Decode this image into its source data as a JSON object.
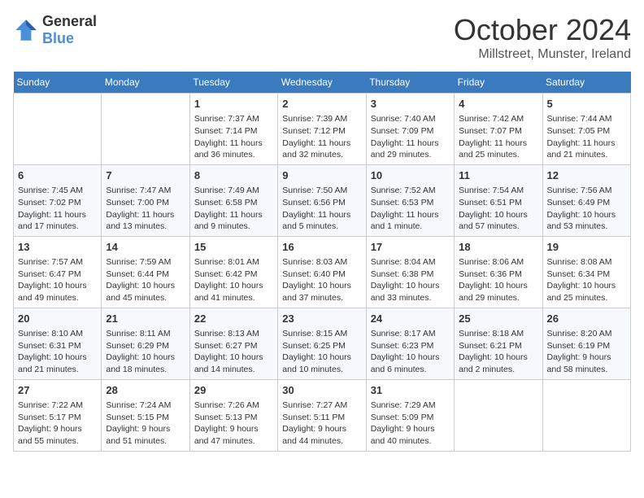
{
  "header": {
    "logo_line1": "General",
    "logo_line2": "Blue",
    "title": "October 2024",
    "subtitle": "Millstreet, Munster, Ireland"
  },
  "days_of_week": [
    "Sunday",
    "Monday",
    "Tuesday",
    "Wednesday",
    "Thursday",
    "Friday",
    "Saturday"
  ],
  "weeks": [
    [
      {
        "day": "",
        "content": ""
      },
      {
        "day": "",
        "content": ""
      },
      {
        "day": "1",
        "content": "Sunrise: 7:37 AM\nSunset: 7:14 PM\nDaylight: 11 hours and 36 minutes."
      },
      {
        "day": "2",
        "content": "Sunrise: 7:39 AM\nSunset: 7:12 PM\nDaylight: 11 hours and 32 minutes."
      },
      {
        "day": "3",
        "content": "Sunrise: 7:40 AM\nSunset: 7:09 PM\nDaylight: 11 hours and 29 minutes."
      },
      {
        "day": "4",
        "content": "Sunrise: 7:42 AM\nSunset: 7:07 PM\nDaylight: 11 hours and 25 minutes."
      },
      {
        "day": "5",
        "content": "Sunrise: 7:44 AM\nSunset: 7:05 PM\nDaylight: 11 hours and 21 minutes."
      }
    ],
    [
      {
        "day": "6",
        "content": "Sunrise: 7:45 AM\nSunset: 7:02 PM\nDaylight: 11 hours and 17 minutes."
      },
      {
        "day": "7",
        "content": "Sunrise: 7:47 AM\nSunset: 7:00 PM\nDaylight: 11 hours and 13 minutes."
      },
      {
        "day": "8",
        "content": "Sunrise: 7:49 AM\nSunset: 6:58 PM\nDaylight: 11 hours and 9 minutes."
      },
      {
        "day": "9",
        "content": "Sunrise: 7:50 AM\nSunset: 6:56 PM\nDaylight: 11 hours and 5 minutes."
      },
      {
        "day": "10",
        "content": "Sunrise: 7:52 AM\nSunset: 6:53 PM\nDaylight: 11 hours and 1 minute."
      },
      {
        "day": "11",
        "content": "Sunrise: 7:54 AM\nSunset: 6:51 PM\nDaylight: 10 hours and 57 minutes."
      },
      {
        "day": "12",
        "content": "Sunrise: 7:56 AM\nSunset: 6:49 PM\nDaylight: 10 hours and 53 minutes."
      }
    ],
    [
      {
        "day": "13",
        "content": "Sunrise: 7:57 AM\nSunset: 6:47 PM\nDaylight: 10 hours and 49 minutes."
      },
      {
        "day": "14",
        "content": "Sunrise: 7:59 AM\nSunset: 6:44 PM\nDaylight: 10 hours and 45 minutes."
      },
      {
        "day": "15",
        "content": "Sunrise: 8:01 AM\nSunset: 6:42 PM\nDaylight: 10 hours and 41 minutes."
      },
      {
        "day": "16",
        "content": "Sunrise: 8:03 AM\nSunset: 6:40 PM\nDaylight: 10 hours and 37 minutes."
      },
      {
        "day": "17",
        "content": "Sunrise: 8:04 AM\nSunset: 6:38 PM\nDaylight: 10 hours and 33 minutes."
      },
      {
        "day": "18",
        "content": "Sunrise: 8:06 AM\nSunset: 6:36 PM\nDaylight: 10 hours and 29 minutes."
      },
      {
        "day": "19",
        "content": "Sunrise: 8:08 AM\nSunset: 6:34 PM\nDaylight: 10 hours and 25 minutes."
      }
    ],
    [
      {
        "day": "20",
        "content": "Sunrise: 8:10 AM\nSunset: 6:31 PM\nDaylight: 10 hours and 21 minutes."
      },
      {
        "day": "21",
        "content": "Sunrise: 8:11 AM\nSunset: 6:29 PM\nDaylight: 10 hours and 18 minutes."
      },
      {
        "day": "22",
        "content": "Sunrise: 8:13 AM\nSunset: 6:27 PM\nDaylight: 10 hours and 14 minutes."
      },
      {
        "day": "23",
        "content": "Sunrise: 8:15 AM\nSunset: 6:25 PM\nDaylight: 10 hours and 10 minutes."
      },
      {
        "day": "24",
        "content": "Sunrise: 8:17 AM\nSunset: 6:23 PM\nDaylight: 10 hours and 6 minutes."
      },
      {
        "day": "25",
        "content": "Sunrise: 8:18 AM\nSunset: 6:21 PM\nDaylight: 10 hours and 2 minutes."
      },
      {
        "day": "26",
        "content": "Sunrise: 8:20 AM\nSunset: 6:19 PM\nDaylight: 9 hours and 58 minutes."
      }
    ],
    [
      {
        "day": "27",
        "content": "Sunrise: 7:22 AM\nSunset: 5:17 PM\nDaylight: 9 hours and 55 minutes."
      },
      {
        "day": "28",
        "content": "Sunrise: 7:24 AM\nSunset: 5:15 PM\nDaylight: 9 hours and 51 minutes."
      },
      {
        "day": "29",
        "content": "Sunrise: 7:26 AM\nSunset: 5:13 PM\nDaylight: 9 hours and 47 minutes."
      },
      {
        "day": "30",
        "content": "Sunrise: 7:27 AM\nSunset: 5:11 PM\nDaylight: 9 hours and 44 minutes."
      },
      {
        "day": "31",
        "content": "Sunrise: 7:29 AM\nSunset: 5:09 PM\nDaylight: 9 hours and 40 minutes."
      },
      {
        "day": "",
        "content": ""
      },
      {
        "day": "",
        "content": ""
      }
    ]
  ]
}
